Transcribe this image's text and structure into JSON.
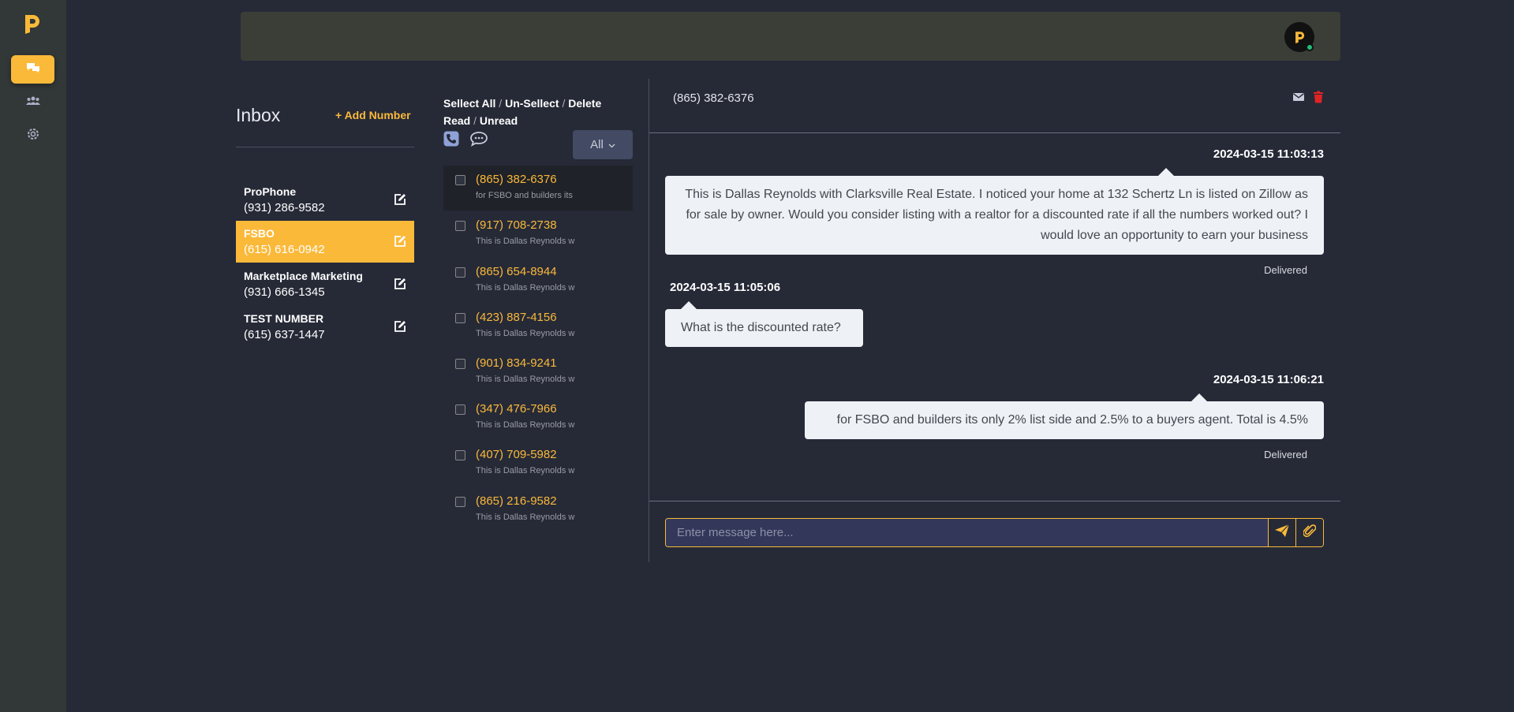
{
  "colors": {
    "accent": "#fbb93a",
    "sidebar": "#323737",
    "background": "#262a37",
    "danger": "#e02424"
  },
  "sidebar": {
    "logo": "brand-logo",
    "items": [
      {
        "icon": "chat-bubbles-icon",
        "active": true
      },
      {
        "icon": "users-icon",
        "active": false
      },
      {
        "icon": "gear-icon",
        "active": false
      }
    ]
  },
  "inbox": {
    "title": "Inbox",
    "add_label": "Add Number",
    "numbers": [
      {
        "name": "ProPhone",
        "phone": "(931) 286-9582",
        "active": false
      },
      {
        "name": "FSBO",
        "phone": "(615) 616-0942",
        "active": true
      },
      {
        "name": "Marketplace Marketing",
        "phone": "(931) 666-1345",
        "active": false
      },
      {
        "name": "TEST NUMBER",
        "phone": "(615) 637-1447",
        "active": false
      }
    ]
  },
  "list": {
    "select_all": "Sellect All",
    "unselect": "Un-Sellect",
    "delete": "Delete",
    "read": "Read",
    "unread": "Unread",
    "filter": "All",
    "conversations": [
      {
        "phone": "(865) 382-6376",
        "preview": "for FSBO and builders its",
        "active": true
      },
      {
        "phone": "(917) 708-2738",
        "preview": "This is Dallas Reynolds w",
        "active": false
      },
      {
        "phone": "(865) 654-8944",
        "preview": "This is Dallas Reynolds w",
        "active": false
      },
      {
        "phone": "(423) 887-4156",
        "preview": "This is Dallas Reynolds w",
        "active": false
      },
      {
        "phone": "(901) 834-9241",
        "preview": "This is Dallas Reynolds w",
        "active": false
      },
      {
        "phone": "(347) 476-7966",
        "preview": "This is Dallas Reynolds w",
        "active": false
      },
      {
        "phone": "(407) 709-5982",
        "preview": "This is Dallas Reynolds w",
        "active": false
      },
      {
        "phone": "(865) 216-9582",
        "preview": "This is Dallas Reynolds w",
        "active": false
      }
    ]
  },
  "chat": {
    "phone": "(865) 382-6376",
    "messages": [
      {
        "direction": "outgoing",
        "timestamp": "2024-03-15 11:03:13",
        "text": "This is Dallas Reynolds with Clarksville Real Estate. I noticed your home at 132 Schertz Ln is listed on Zillow as for sale by owner. Would you consider listing with a realtor for a discounted rate if all the numbers worked out? I would love an opportunity to earn your business",
        "status": "Delivered"
      },
      {
        "direction": "incoming",
        "timestamp": "2024-03-15 11:05:06",
        "text": "What is the discounted rate?"
      },
      {
        "direction": "outgoing",
        "timestamp": "2024-03-15 11:06:21",
        "text": "for FSBO and builders its only 2% list side and 2.5% to a buyers agent. Total is 4.5%",
        "status": "Delivered"
      }
    ],
    "composer_placeholder": "Enter message here..."
  }
}
